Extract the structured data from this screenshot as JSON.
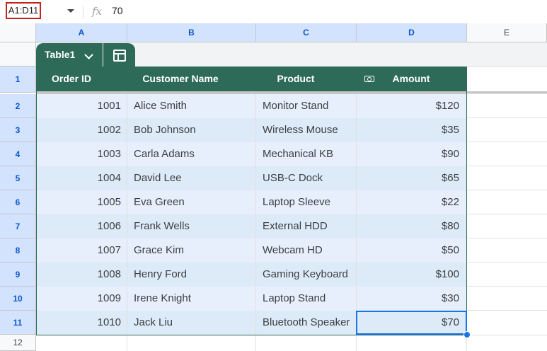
{
  "formula_bar": {
    "name_box": "A1:D11",
    "fx": "fx",
    "value": "70"
  },
  "columns": [
    "A",
    "B",
    "C",
    "D",
    "E"
  ],
  "rows": [
    "1",
    "2",
    "3",
    "4",
    "5",
    "6",
    "7",
    "8",
    "9",
    "10",
    "11",
    "12"
  ],
  "table": {
    "name": "Table1",
    "headers": [
      "Order ID",
      "Customer Name",
      "Product",
      "Amount"
    ],
    "data": [
      [
        "1001",
        "Alice Smith",
        "Monitor Stand",
        "$120"
      ],
      [
        "1002",
        "Bob Johnson",
        "Wireless Mouse",
        "$35"
      ],
      [
        "1003",
        "Carla Adams",
        "Mechanical KB",
        "$90"
      ],
      [
        "1004",
        "David Lee",
        "USB-C Dock",
        "$65"
      ],
      [
        "1005",
        "Eva Green",
        "Laptop Sleeve",
        "$22"
      ],
      [
        "1006",
        "Frank Wells",
        "External HDD",
        "$80"
      ],
      [
        "1007",
        "Grace Kim",
        "Webcam HD",
        "$50"
      ],
      [
        "1008",
        "Henry Ford",
        "Gaming Keyboard",
        "$100"
      ],
      [
        "1009",
        "Irene Knight",
        "Laptop Stand",
        "$30"
      ],
      [
        "1010",
        "Jack Liu",
        "Bluetooth Speaker",
        "$70"
      ]
    ]
  },
  "colors": {
    "table_header": "#2d6a58",
    "selection": "#1a73e8",
    "name_box_border": "#c5221f"
  },
  "icons": {
    "table_settings": "table-settings-icon",
    "amount_type": "currency-icon"
  }
}
